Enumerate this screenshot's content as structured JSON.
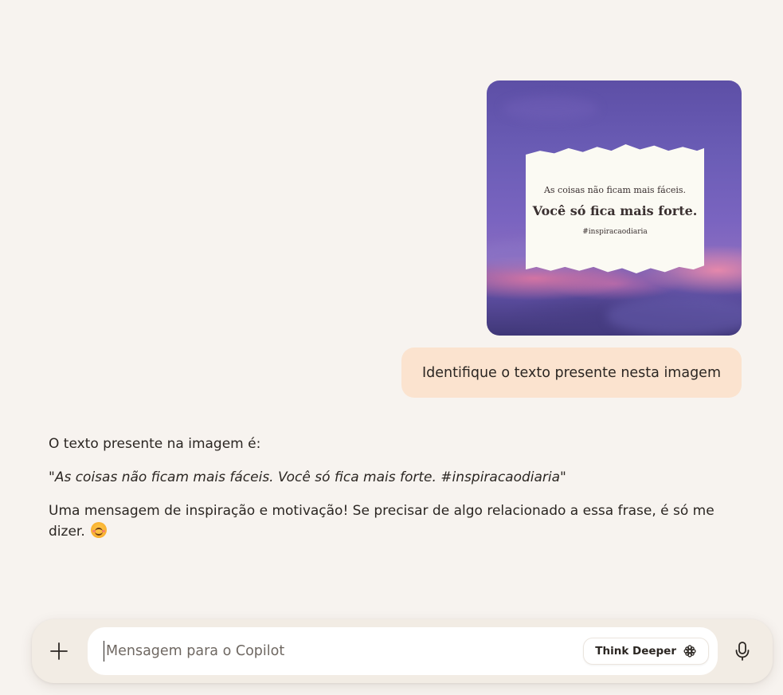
{
  "conversation": {
    "user_image": {
      "alt": "Imagem com céu roxo e papel rasgado",
      "line1": "As coisas não ficam mais fáceis.",
      "line2": "Você só fica mais forte.",
      "hashtag": "#inspiracaodiaria"
    },
    "user_message": "Identifique o texto presente nesta imagem",
    "assistant": {
      "intro": "O texto presente na imagem é:",
      "quote": "\"As coisas não ficam mais fáceis. Você só fica mais forte. #inspiracaodiaria\"",
      "closing": "Uma mensagem de inspiração e motivação! Se precisar de algo relacionado a essa frase, é só me dizer.",
      "emoji_icon": "smiling-face-icon"
    }
  },
  "composer": {
    "placeholder": "Mensagem para o Copilot",
    "value": "",
    "think_deeper_label": "Think Deeper",
    "icons": {
      "add": "plus-icon",
      "think": "think-deeper-icon",
      "mic": "microphone-icon"
    }
  },
  "colors": {
    "background": "#f7f3ef",
    "user_bubble": "#fbe3cf",
    "composer": "#f2ece4",
    "text": "#2b2622"
  }
}
